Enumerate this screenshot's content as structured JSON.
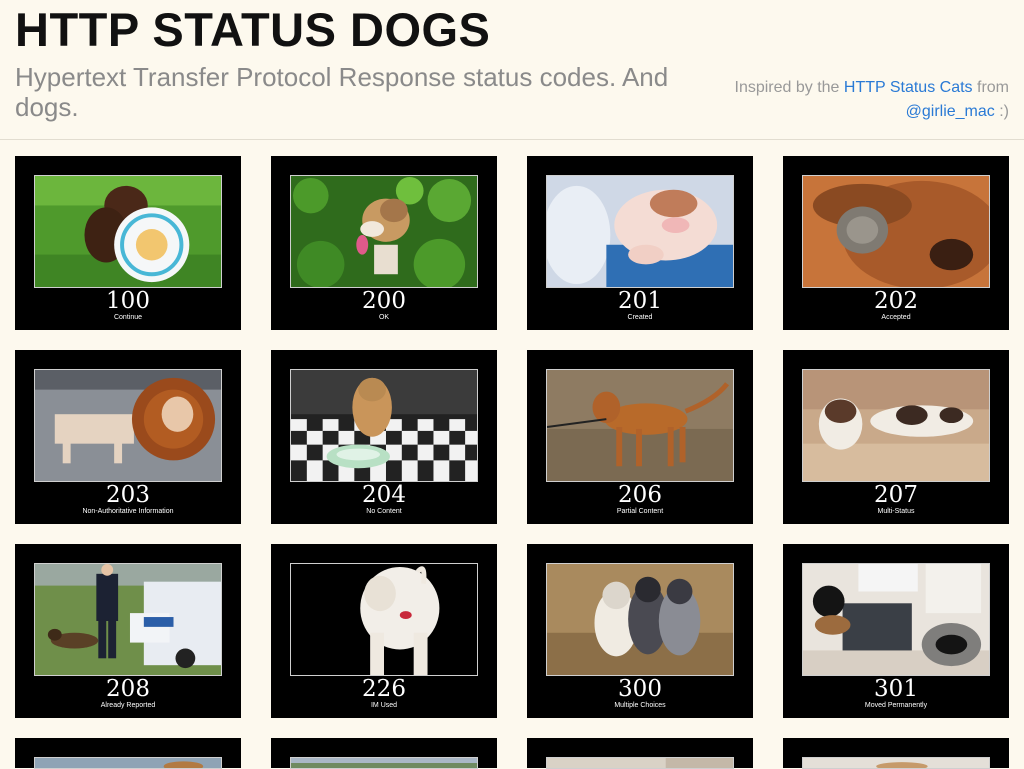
{
  "header": {
    "title": "HTTP STATUS DOGS",
    "subtitle": "Hypertext Transfer Protocol Response status codes. And dogs.",
    "credit_prefix": "Inspired by the ",
    "credit_link": "HTTP Status Cats",
    "credit_mid": " from",
    "credit_handle": "@girlie_mac",
    "credit_suffix": " :)"
  },
  "colors": {
    "background": "#fdf9ee",
    "link": "#2a7ad5",
    "card": "#000000"
  },
  "cards": [
    {
      "code": "100",
      "description": "Continue",
      "scene": "brown puppy with frisbee on grass"
    },
    {
      "code": "200",
      "description": "OK",
      "scene": "dog in green leaves"
    },
    {
      "code": "201",
      "description": "Created",
      "scene": "newborn pink puppy on blanket"
    },
    {
      "code": "202",
      "description": "Accepted",
      "scene": "kitten with bloodhound"
    },
    {
      "code": "203",
      "description": "Non-Authoritative Information",
      "scene": "dog in lion costume"
    },
    {
      "code": "204",
      "description": "No Content",
      "scene": "dog by empty bowl on checkered floor"
    },
    {
      "code": "206",
      "description": "Partial Content",
      "scene": "brown hound on leash"
    },
    {
      "code": "207",
      "description": "Multi-Status",
      "scene": "two puppies on couch"
    },
    {
      "code": "208",
      "description": "Already Reported",
      "scene": "police officer with dog by patrol car"
    },
    {
      "code": "226",
      "description": "IM Used",
      "scene": "white dog from behind with lipstick mark"
    },
    {
      "code": "300",
      "description": "Multiple Choices",
      "scene": "three puppies"
    },
    {
      "code": "301",
      "description": "Moved Permanently",
      "scene": "dog moved from bed to room"
    },
    {
      "code": "",
      "description": "",
      "scene": "partial row"
    },
    {
      "code": "",
      "description": "",
      "scene": "partial row"
    },
    {
      "code": "",
      "description": "",
      "scene": "partial row"
    },
    {
      "code": "",
      "description": "",
      "scene": "partial row"
    }
  ]
}
